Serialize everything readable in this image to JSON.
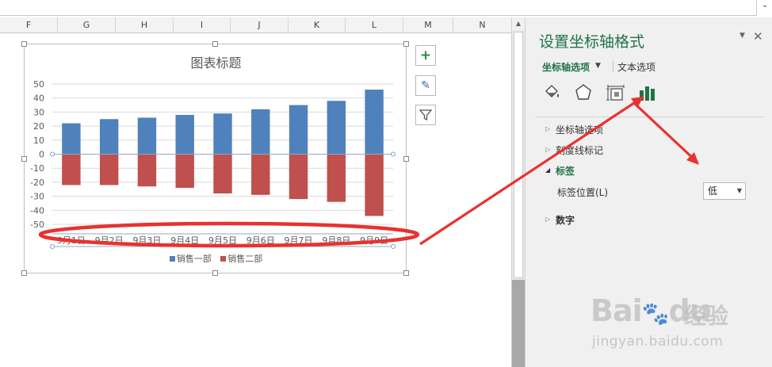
{
  "sheet": {
    "columns": [
      "F",
      "G",
      "H",
      "I",
      "J",
      "K",
      "L",
      "M",
      "N"
    ]
  },
  "chart_buttons": {
    "add": "+",
    "style": "✎",
    "filter": "funnel"
  },
  "chart_data": {
    "type": "bar",
    "title": "图表标题",
    "categories": [
      "9月1日",
      "9月2日",
      "9月3日",
      "9月4日",
      "9月5日",
      "9月6日",
      "9月7日",
      "9月8日",
      "9月9日"
    ],
    "series": [
      {
        "name": "销售一部",
        "color": "#4f81bd",
        "values": [
          22,
          25,
          26,
          28,
          29,
          32,
          35,
          38,
          46
        ]
      },
      {
        "name": "销售二部",
        "color": "#c0504d",
        "values": [
          -22,
          -22,
          -23,
          -24,
          -28,
          -29,
          -32,
          -34,
          -44
        ]
      }
    ],
    "yticks": [
      50,
      40,
      30,
      20,
      10,
      0,
      -10,
      -20,
      -30,
      -40,
      -50
    ],
    "ylim": [
      -50,
      50
    ],
    "grid": true,
    "legend_position": "bottom"
  },
  "pane": {
    "title": "设置坐标轴格式",
    "tab_axis": "坐标轴选项",
    "tab_text": "文本选项",
    "sections": {
      "axis_options": "坐标轴选项",
      "tick_marks": "刻度线标记",
      "labels": "标签",
      "number": "数字"
    },
    "label_position_label": "标签位置(L)",
    "label_position_value": "低",
    "icons": [
      "fill-line-icon",
      "effects-icon",
      "size-properties-icon",
      "axis-options-icon"
    ]
  },
  "watermark": {
    "brand": "Bai",
    "brand_cn": "经验",
    "url": "jingyan.baidu.com"
  },
  "colors": {
    "accent": "#217346",
    "annotation": "#e8322f"
  }
}
